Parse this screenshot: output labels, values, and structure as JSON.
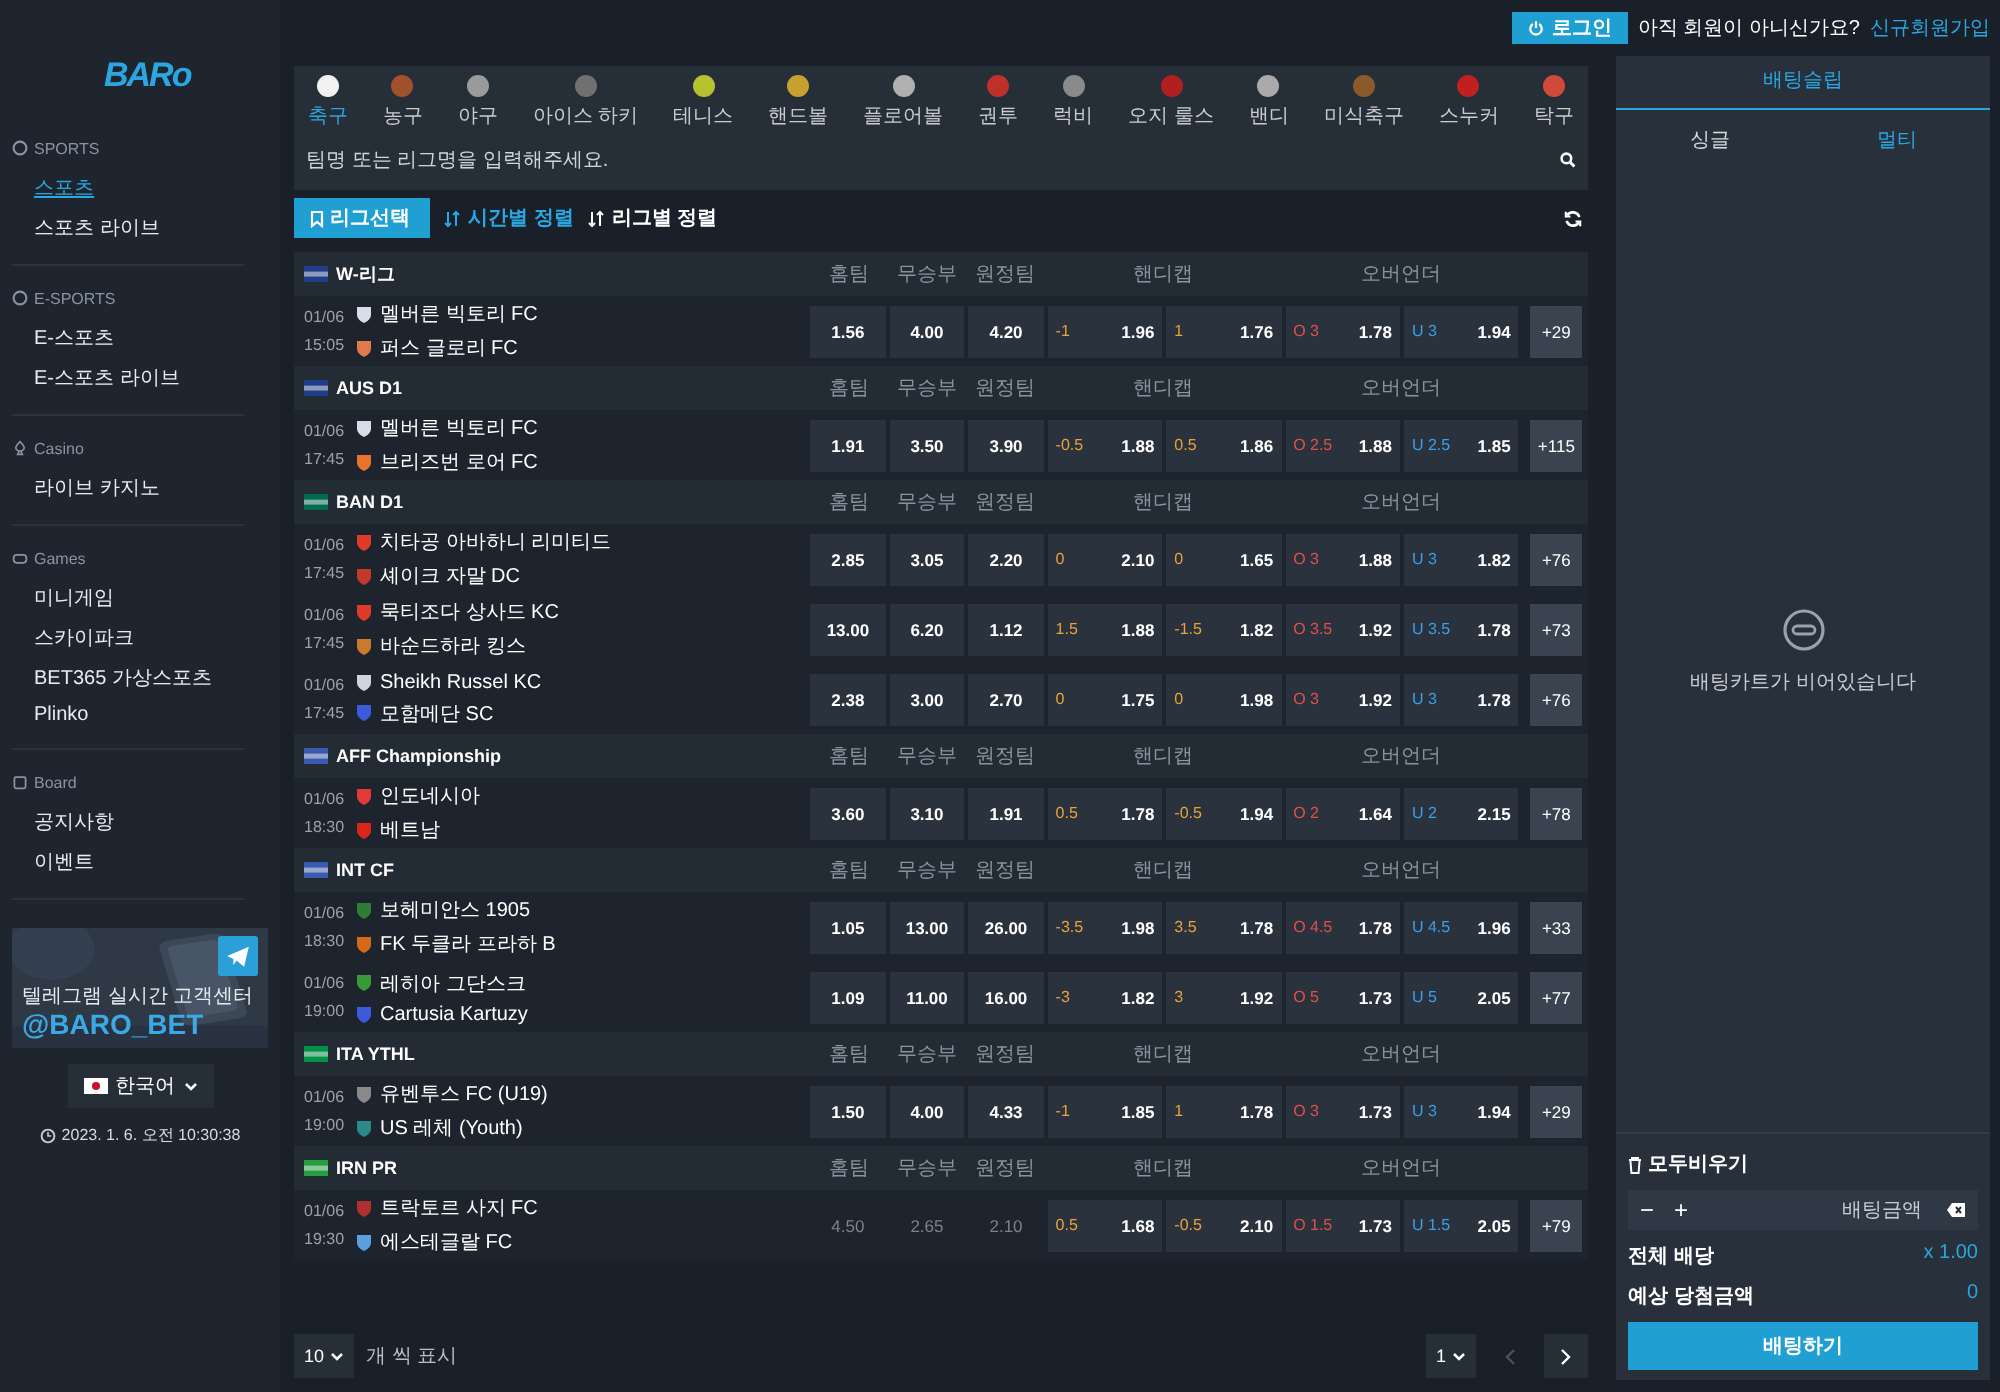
{
  "logo": "BARo",
  "sidebar": {
    "sections": [
      {
        "title": "SPORTS",
        "kind": "sports",
        "items": [
          {
            "label": "스포츠",
            "selected": true
          },
          {
            "label": "스포츠 라이브",
            "selected": false
          }
        ]
      },
      {
        "title": "E-SPORTS",
        "kind": "sports",
        "items": [
          {
            "label": "E-스포츠",
            "selected": false
          },
          {
            "label": "E-스포츠 라이브",
            "selected": false
          }
        ]
      },
      {
        "title": "Casino",
        "kind": "casino",
        "items": [
          {
            "label": "라이브 카지노",
            "selected": false
          }
        ]
      },
      {
        "title": "Games",
        "kind": "games",
        "items": [
          {
            "label": "미니게임",
            "selected": false
          },
          {
            "label": "스카이파크",
            "selected": false
          },
          {
            "label": "BET365 가상스포츠",
            "selected": false
          },
          {
            "label": "Plinko",
            "selected": false
          }
        ]
      },
      {
        "title": "Board",
        "kind": "board",
        "items": [
          {
            "label": "공지사항",
            "selected": false
          },
          {
            "label": "이벤트",
            "selected": false
          }
        ]
      }
    ],
    "banner": {
      "kind": "picture",
      "line1": "텔레그램 실시간 고객센터",
      "line2": "@BARO_BET"
    },
    "language": "한국어",
    "clock": "2023. 1. 6. 오전 10:30:38"
  },
  "sports_tabs": [
    {
      "label": "축구",
      "selected": true,
      "color": "#f2f2f2"
    },
    {
      "label": "농구",
      "selected": false,
      "color": "#a0522d"
    },
    {
      "label": "야구",
      "selected": false,
      "color": "#9a9a9a"
    },
    {
      "label": "아이스 하키",
      "selected": false,
      "color": "#707070"
    },
    {
      "label": "테니스",
      "selected": false,
      "color": "#b5c230"
    },
    {
      "label": "핸드볼",
      "selected": false,
      "color": "#c8a030"
    },
    {
      "label": "플로어볼",
      "selected": false,
      "color": "#b0b0b0"
    },
    {
      "label": "권투",
      "selected": false,
      "color": "#c0302a"
    },
    {
      "label": "럭비",
      "selected": false,
      "color": "#8a8a8a"
    },
    {
      "label": "오지 룰스",
      "selected": false,
      "color": "#b02020"
    },
    {
      "label": "밴디",
      "selected": false,
      "color": "#aaaaaa"
    },
    {
      "label": "미식축구",
      "selected": false,
      "color": "#8b5a2b"
    },
    {
      "label": "스누커",
      "selected": false,
      "color": "#c02020"
    },
    {
      "label": "탁구",
      "selected": false,
      "color": "#d04a3a"
    }
  ],
  "search": {
    "placeholder": "팀명 또는 리그명을 입력해주세요."
  },
  "toolbar": {
    "league_button": "리그선택",
    "sorts": [
      {
        "label": "시간별 정렬",
        "selected": true
      },
      {
        "label": "리그별 정렬",
        "selected": false
      }
    ]
  },
  "leagues": [
    {
      "name": "W-리그",
      "color": "#1f3d8a",
      "headers": [
        "홈팀",
        "무승부",
        "원정팀",
        "핸디캡",
        "오버언더"
      ],
      "matches": [
        {
          "date": "01/06",
          "time": "15:05",
          "teams": [
            {
              "name": "멜버른 빅토리 FC",
              "color": "#d8dce8"
            },
            {
              "name": "퍼스 글로리 FC",
              "color": "#e07a4a"
            }
          ],
          "odds": [
            "1.56",
            "4.00",
            "4.20"
          ],
          "odds_disabled": false,
          "handicap": [
            {
              "line": "-1",
              "odd": "1.96"
            },
            {
              "line": "1",
              "odd": "1.76"
            }
          ],
          "totals": [
            {
              "kind": "over",
              "line": "O 3",
              "odd": "1.78"
            },
            {
              "kind": "under",
              "line": "U 3",
              "odd": "1.94"
            }
          ],
          "more": "+29"
        }
      ]
    },
    {
      "name": "AUS D1",
      "color": "#1f3d8a",
      "headers": [
        "홈팀",
        "무승부",
        "원정팀",
        "핸디캡",
        "오버언더"
      ],
      "matches": [
        {
          "date": "01/06",
          "time": "17:45",
          "teams": [
            {
              "name": "멜버른 빅토리 FC",
              "color": "#d8dce8"
            },
            {
              "name": "브리즈번 로어 FC",
              "color": "#e8732a"
            }
          ],
          "odds": [
            "1.91",
            "3.50",
            "3.90"
          ],
          "odds_disabled": false,
          "handicap": [
            {
              "line": "-0.5",
              "odd": "1.88"
            },
            {
              "line": "0.5",
              "odd": "1.86"
            }
          ],
          "totals": [
            {
              "kind": "over",
              "line": "O 2.5",
              "odd": "1.88"
            },
            {
              "kind": "under",
              "line": "U 2.5",
              "odd": "1.85"
            }
          ],
          "more": "+115"
        }
      ]
    },
    {
      "name": "BAN D1",
      "color": "#006a4e",
      "headers": [
        "홈팀",
        "무승부",
        "원정팀",
        "핸디캡",
        "오버언더"
      ],
      "matches": [
        {
          "date": "01/06",
          "time": "17:45",
          "teams": [
            {
              "name": "치타공 아바하니 리미티드",
              "color": "#e03a2a"
            },
            {
              "name": "셰이크 자말 DC",
              "color": "#c0392b"
            }
          ],
          "odds": [
            "2.85",
            "3.05",
            "2.20"
          ],
          "odds_disabled": false,
          "handicap": [
            {
              "line": "0",
              "odd": "2.10"
            },
            {
              "line": "0",
              "odd": "1.65"
            }
          ],
          "totals": [
            {
              "kind": "over",
              "line": "O 3",
              "odd": "1.88"
            },
            {
              "kind": "under",
              "line": "U 3",
              "odd": "1.82"
            }
          ],
          "more": "+76"
        },
        {
          "date": "01/06",
          "time": "17:45",
          "teams": [
            {
              "name": "묵티조다 상사드 KC",
              "color": "#e03a2a"
            },
            {
              "name": "바순드하라 킹스",
              "color": "#c97a2a"
            }
          ],
          "odds": [
            "13.00",
            "6.20",
            "1.12"
          ],
          "odds_disabled": false,
          "handicap": [
            {
              "line": "1.5",
              "odd": "1.88"
            },
            {
              "line": "-1.5",
              "odd": "1.82"
            }
          ],
          "totals": [
            {
              "kind": "over",
              "line": "O 3.5",
              "odd": "1.92"
            },
            {
              "kind": "under",
              "line": "U 3.5",
              "odd": "1.78"
            }
          ],
          "more": "+73"
        },
        {
          "date": "01/06",
          "time": "17:45",
          "teams": [
            {
              "name": "Sheikh Russel KC",
              "color": "#d0d4dc"
            },
            {
              "name": "모함메단 SC",
              "color": "#3b5bdb"
            }
          ],
          "odds": [
            "2.38",
            "3.00",
            "2.70"
          ],
          "odds_disabled": false,
          "handicap": [
            {
              "line": "0",
              "odd": "1.75"
            },
            {
              "line": "0",
              "odd": "1.98"
            }
          ],
          "totals": [
            {
              "kind": "over",
              "line": "O 3",
              "odd": "1.92"
            },
            {
              "kind": "under",
              "line": "U 3",
              "odd": "1.78"
            }
          ],
          "more": "+76"
        }
      ]
    },
    {
      "name": "AFF Championship",
      "color": "#3a5ab0",
      "headers": [
        "홈팀",
        "무승부",
        "원정팀",
        "핸디캡",
        "오버언더"
      ],
      "matches": [
        {
          "date": "01/06",
          "time": "18:30",
          "teams": [
            {
              "name": "인도네시아",
              "color": "#e03a3a"
            },
            {
              "name": "베트남",
              "color": "#da251d"
            }
          ],
          "odds": [
            "3.60",
            "3.10",
            "1.91"
          ],
          "odds_disabled": false,
          "handicap": [
            {
              "line": "0.5",
              "odd": "1.78"
            },
            {
              "line": "-0.5",
              "odd": "1.94"
            }
          ],
          "totals": [
            {
              "kind": "over",
              "line": "O 2",
              "odd": "1.64"
            },
            {
              "kind": "under",
              "line": "U 2",
              "odd": "2.15"
            }
          ],
          "more": "+78"
        }
      ]
    },
    {
      "name": "INT CF",
      "color": "#3a5ab0",
      "headers": [
        "홈팀",
        "무승부",
        "원정팀",
        "핸디캡",
        "오버언더"
      ],
      "matches": [
        {
          "date": "01/06",
          "time": "18:30",
          "teams": [
            {
              "name": "보헤미안스 1905",
              "color": "#2e7d32"
            },
            {
              "name": "FK 두클라 프라하 B",
              "color": "#d4691a"
            }
          ],
          "odds": [
            "1.05",
            "13.00",
            "26.00"
          ],
          "odds_disabled": false,
          "handicap": [
            {
              "line": "-3.5",
              "odd": "1.98"
            },
            {
              "line": "3.5",
              "odd": "1.78"
            }
          ],
          "totals": [
            {
              "kind": "over",
              "line": "O 4.5",
              "odd": "1.78"
            },
            {
              "kind": "under",
              "line": "U 4.5",
              "odd": "1.96"
            }
          ],
          "more": "+33"
        },
        {
          "date": "01/06",
          "time": "19:00",
          "teams": [
            {
              "name": "레히아 그단스크",
              "color": "#3a9a3a"
            },
            {
              "name": "Cartusia Kartuzy",
              "color": "#3b5bdb"
            }
          ],
          "odds": [
            "1.09",
            "11.00",
            "16.00"
          ],
          "odds_disabled": false,
          "handicap": [
            {
              "line": "-3",
              "odd": "1.82"
            },
            {
              "line": "3",
              "odd": "1.92"
            }
          ],
          "totals": [
            {
              "kind": "over",
              "line": "O 5",
              "odd": "1.73"
            },
            {
              "kind": "under",
              "line": "U 5",
              "odd": "2.05"
            }
          ],
          "more": "+77"
        }
      ]
    },
    {
      "name": "ITA YTHL",
      "color": "#009246",
      "headers": [
        "홈팀",
        "무승부",
        "원정팀",
        "핸디캡",
        "오버언더"
      ],
      "matches": [
        {
          "date": "01/06",
          "time": "19:00",
          "teams": [
            {
              "name": "유벤투스 FC (U19)",
              "color": "#8a8a8a"
            },
            {
              "name": "US 레체 (Youth)",
              "color": "#2a8a8a"
            }
          ],
          "odds": [
            "1.50",
            "4.00",
            "4.33"
          ],
          "odds_disabled": false,
          "handicap": [
            {
              "line": "-1",
              "odd": "1.85"
            },
            {
              "line": "1",
              "odd": "1.78"
            }
          ],
          "totals": [
            {
              "kind": "over",
              "line": "O 3",
              "odd": "1.73"
            },
            {
              "kind": "under",
              "line": "U 3",
              "odd": "1.94"
            }
          ],
          "more": "+29"
        }
      ]
    },
    {
      "name": "IRN PR",
      "color": "#239f40",
      "headers": [
        "홈팀",
        "무승부",
        "원정팀",
        "핸디캡",
        "오버언더"
      ],
      "matches": [
        {
          "date": "01/06",
          "time": "19:30",
          "teams": [
            {
              "name": "트락토르 사지 FC",
              "color": "#b03030"
            },
            {
              "name": "에스테글랄 FC",
              "color": "#5aa0e0"
            }
          ],
          "odds": [
            "4.50",
            "2.65",
            "2.10"
          ],
          "odds_disabled": true,
          "handicap": [
            {
              "line": "0.5",
              "odd": "1.68"
            },
            {
              "line": "-0.5",
              "odd": "2.10"
            }
          ],
          "totals": [
            {
              "kind": "over",
              "line": "O 1.5",
              "odd": "1.73"
            },
            {
              "kind": "under",
              "line": "U 1.5",
              "odd": "2.05"
            }
          ],
          "more": "+79"
        }
      ]
    }
  ],
  "pagination": {
    "page_size": "10",
    "page_size_label": "개 씩 표시",
    "page": "1",
    "prev_disabled": true
  },
  "header": {
    "login": "로그인",
    "prompt": "아직 회원이 아니신가요?",
    "signup": "신규회원가입"
  },
  "betslip": {
    "title": "배팅슬립",
    "tabs": [
      {
        "label": "싱글",
        "selected": false
      },
      {
        "label": "멀티",
        "selected": true
      }
    ],
    "empty": "배팅카트가 비어있습니다",
    "clear": "모두비우기",
    "minus": "−",
    "plus": "+",
    "amount_placeholder": "배팅금액",
    "total_odds_label": "전체 배당",
    "total_odds": "x 1.00",
    "expected_label": "예상 당첨금액",
    "expected": "0",
    "submit": "배팅하기"
  }
}
